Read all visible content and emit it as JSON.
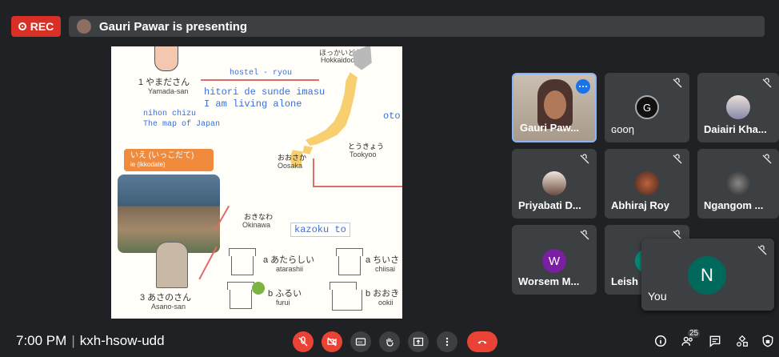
{
  "rec": {
    "label": "REC"
  },
  "presenter": {
    "text": "Gauri Pawar is presenting"
  },
  "slide": {
    "hokkaido_kana": "ほっかいどう",
    "hokkaido": "Hokkaidoo",
    "hostel": "hostel - ryou",
    "sentence_jp": "hitori de sunde imasu",
    "sentence_en": "I am living alone",
    "yamada_kana": "1 やまださん",
    "yamada": "Yamada-san",
    "nihon_chizu": "nihon chizu",
    "map_of_japan": "The map of Japan",
    "oto": "oto",
    "tokyo_kana": "とうきょう",
    "tokyo": "Tookyoo",
    "osaka_kana": "おおさか",
    "osaka": "Oosaka",
    "ie_kana": "いえ (いっこだて)",
    "ie": "ie (ikkodate)",
    "okinawa_kana": "おきなわ",
    "okinawa": "Okinawa",
    "kazoku": "kazoku to",
    "a_atarashii_kana": "a あたらしい",
    "atarashii": "atarashii",
    "a_chiisai_kana": "a ちいさ",
    "chiisai": "chiisai",
    "b_furui_kana": "b ふるい",
    "furui": "furui",
    "b_ookii_kana": "b おおき",
    "ookii": "ookii",
    "asano_kana": "3 あさのさん",
    "asano": "Asano-san"
  },
  "participants": [
    {
      "name": "Gauri Paw...",
      "muted": false
    },
    {
      "name": "ɢooη",
      "muted": true
    },
    {
      "name": "Daiairi Kha...",
      "muted": true
    },
    {
      "name": "Priyabati D...",
      "muted": true
    },
    {
      "name": "Abhiraj Roy",
      "muted": true
    },
    {
      "name": "Ngangom ...",
      "muted": true
    },
    {
      "name": "Worsem M...",
      "muted": true,
      "initial": "W"
    },
    {
      "name": "Leish",
      "muted": true
    }
  ],
  "self_tile": {
    "name": "You",
    "initial": "N"
  },
  "bottom": {
    "time": "7:00 PM",
    "meeting_code": "kxh-hsow-udd",
    "participant_count": "25"
  },
  "colors": {
    "rec_red": "#d93025",
    "leave_red": "#ea4335",
    "w_avatar": "#7b1fa2",
    "n_avatar": "#00695c",
    "teal_avatar": "#00897b"
  }
}
